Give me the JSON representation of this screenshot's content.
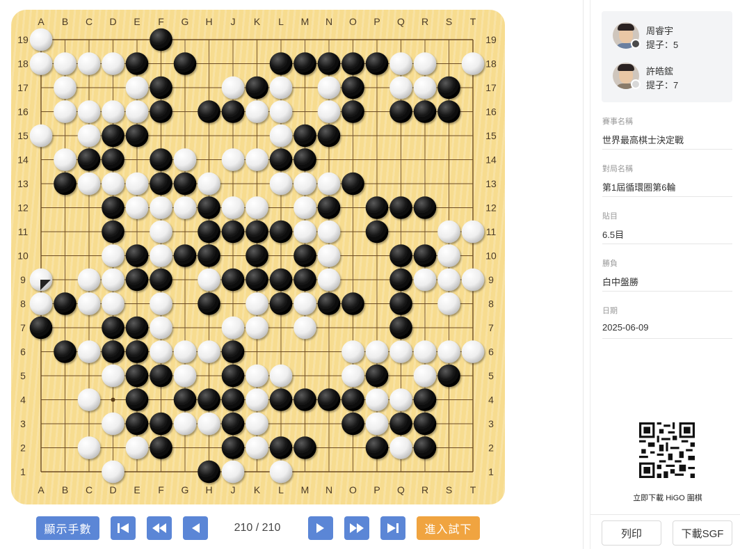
{
  "board": {
    "size": 19,
    "columns": [
      "A",
      "B",
      "C",
      "D",
      "E",
      "F",
      "G",
      "H",
      "J",
      "K",
      "L",
      "M",
      "N",
      "O",
      "P",
      "Q",
      "R",
      "S",
      "T"
    ],
    "rows_top_to_bottom": [
      "19",
      "18",
      "17",
      "16",
      "15",
      "14",
      "13",
      "12",
      "11",
      "10",
      "9",
      "8",
      "7",
      "6",
      "5",
      "4",
      "3",
      "2",
      "1"
    ],
    "grid": [
      "W....B.............",
      "WWWWB.B...BBBBBWW.W",
      ".W..WB..WBW.WB.WWB.",
      ".WWWWB.BBWW.WB.BBB.",
      "W.WBB.....WBB......",
      ".WBB.BW.WWBB.......",
      ".BWWWBBW..WWWB.....",
      "...BWWWBWW.WB.BBB..",
      "...B.W.BBBBWW.B..WW",
      "...WBWBB.B.BW..BBW.",
      "W.WWBB.WBBBBW..BWWW",
      "WBWW.W.B.WBWBB.B.W.",
      "B..BBW..WW.W...B...",
      ".BWBBWWWB....WWWWWW",
      "...WBBW.BWW..WB.WB.",
      "..W.B.BBBWBBBBWWB..",
      "...WBBWWBW...BWBB..",
      "..W.WB..BWBB..BWB..",
      "...W...BW.W........"
    ],
    "last_move": {
      "col": "A",
      "row": "9"
    }
  },
  "controls": {
    "show_numbers": "顯示手數",
    "move_counter": "210 / 210",
    "try_play": "進入試下",
    "first_icon": "skip-to-start-icon",
    "fast_back_icon": "fast-backward-icon",
    "back_icon": "step-back-icon",
    "forward_icon": "step-forward-icon",
    "fast_forward_icon": "fast-forward-icon",
    "last_icon": "skip-to-end-icon"
  },
  "players": [
    {
      "name": "周睿宇",
      "captures": "提子：5",
      "color": "black"
    },
    {
      "name": "許皓鋐",
      "captures": "提子：7",
      "color": "white"
    }
  ],
  "info": [
    {
      "label": "賽事名稱",
      "value": "世界最高棋士決定戰"
    },
    {
      "label": "對局名稱",
      "value": "第1屆循環圈第6輪"
    },
    {
      "label": "貼目",
      "value": "6.5目"
    },
    {
      "label": "勝負",
      "value": "白中盤勝"
    },
    {
      "label": "日期",
      "value": "2025-06-09"
    }
  ],
  "download": {
    "caption": "立即下載 HiGO 圍棋"
  },
  "actions": {
    "print": "列印",
    "download_sgf": "下載SGF"
  },
  "colors": {
    "accent": "#5b86d6",
    "orange": "#f0a440",
    "board": "#f7dc8f"
  }
}
